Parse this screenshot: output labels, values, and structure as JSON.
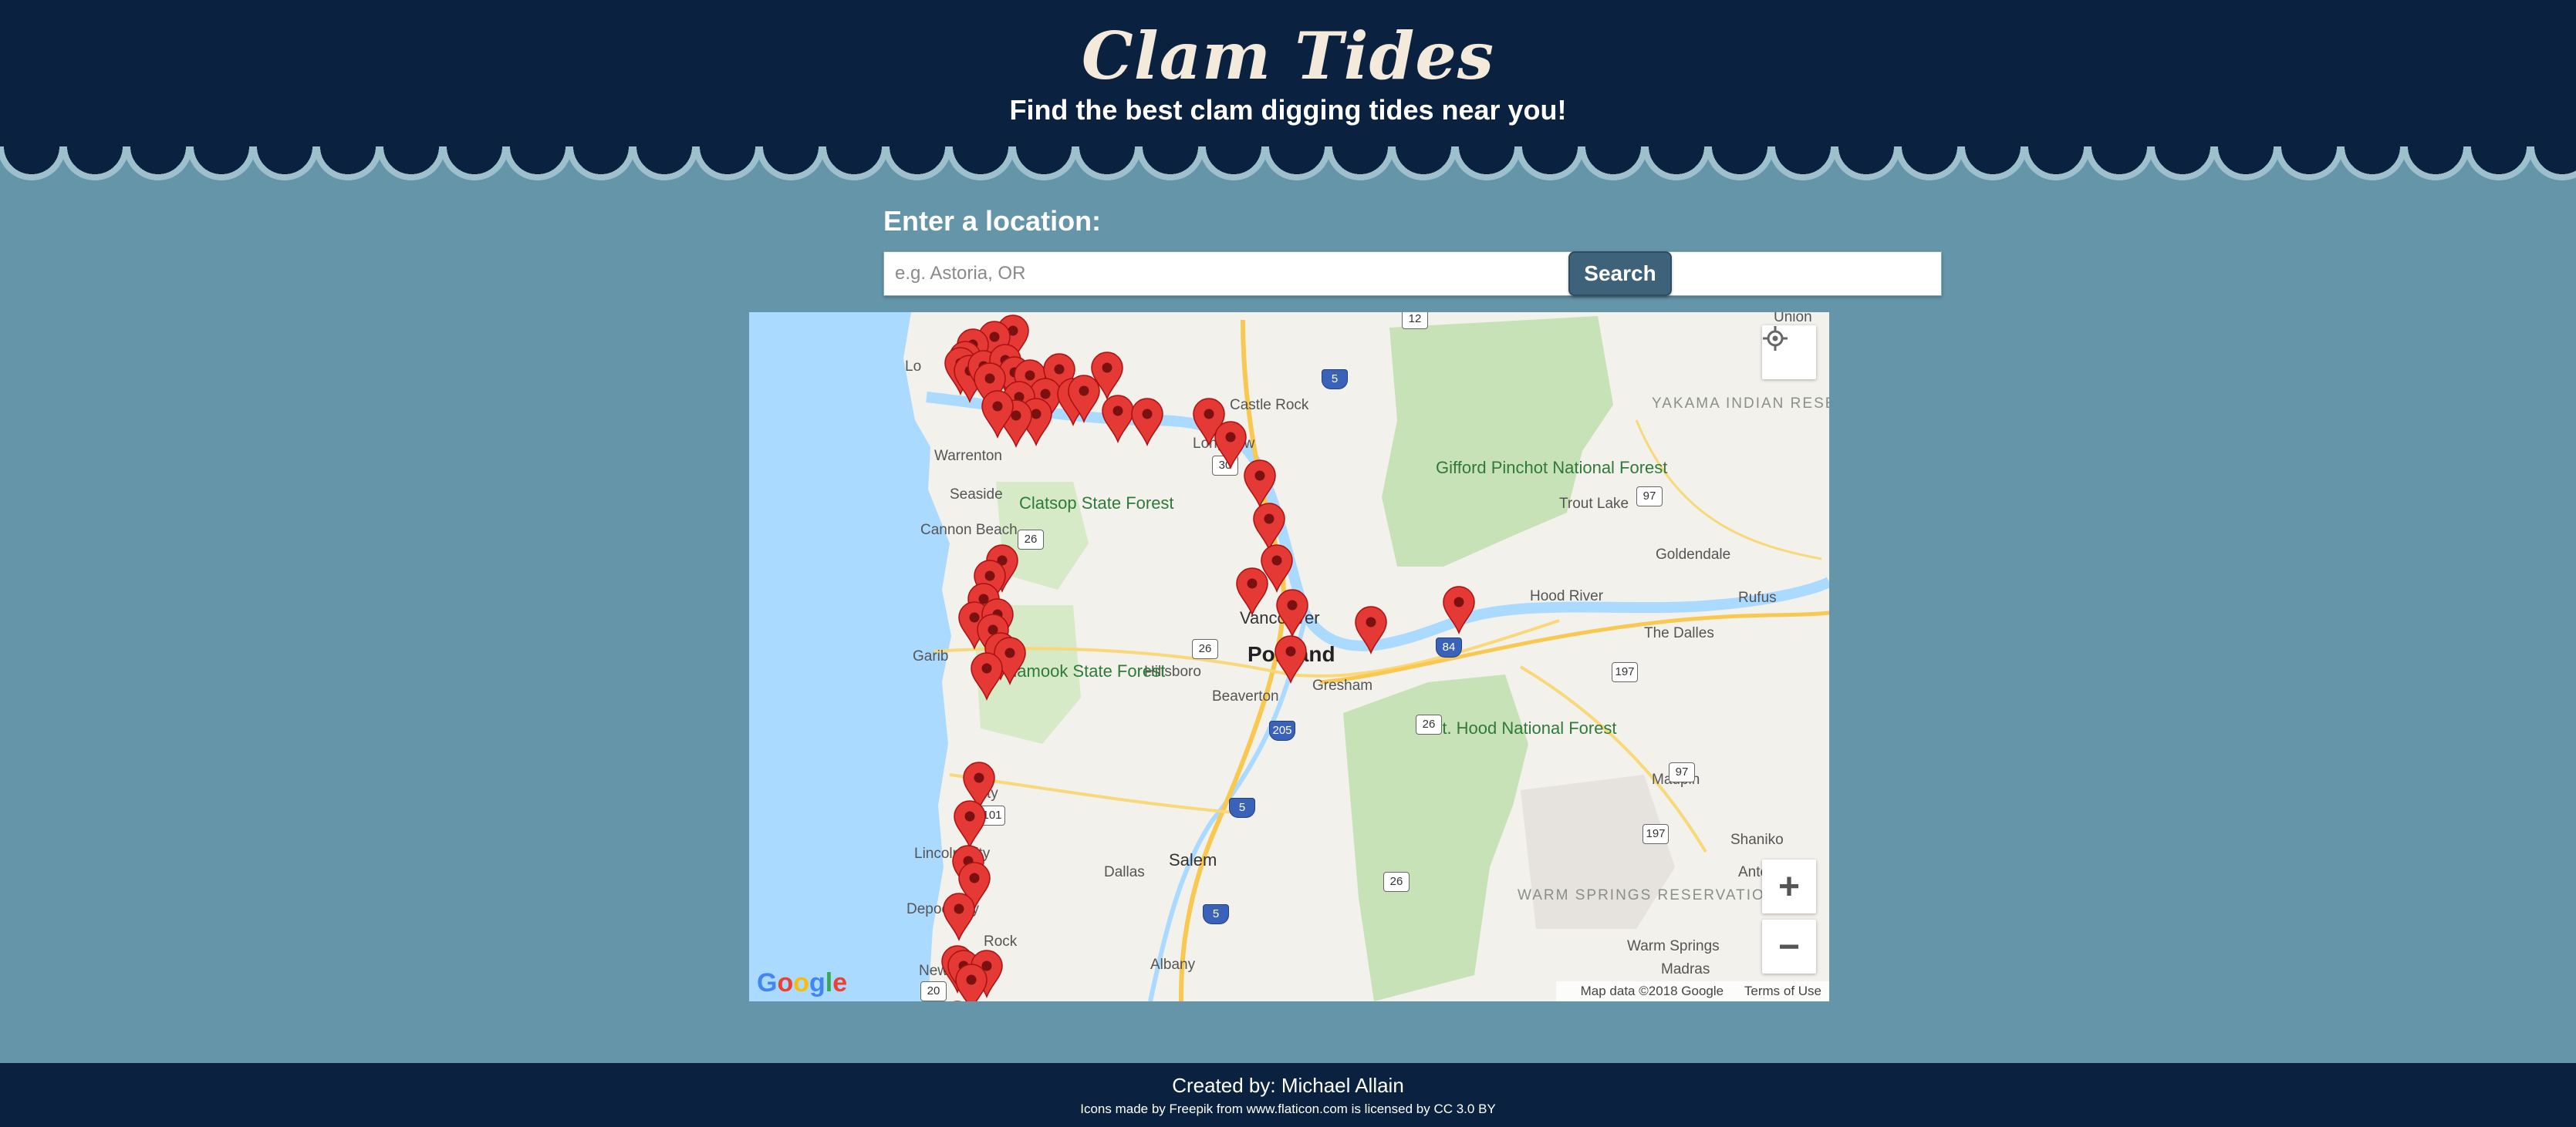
{
  "header": {
    "title": "Clam Tides",
    "subtitle": "Find the best clam digging tides near you!"
  },
  "search": {
    "label": "Enter a location:",
    "placeholder": "e.g. Astoria, OR",
    "button_label": "Search"
  },
  "map": {
    "labels": {
      "union": "Union",
      "castle_rock": "Castle Rock",
      "longview": "Longview",
      "warrenton": "Warrenton",
      "seaside": "Seaside",
      "cannon_beach": "Cannon Beach",
      "clatsop_forest": "Clatsop State Forest",
      "gifford_forest": "Gifford Pinchot National Forest",
      "yakama": "YAKAMA INDIAN RESERVATION",
      "trout_lake": "Trout Lake",
      "goldendale": "Goldendale",
      "hood_river": "Hood River",
      "rufus": "Rufus",
      "the_dalles": "The Dalles",
      "vancouver": "Vancouver",
      "portland": "Portland",
      "hillsboro": "Hillsboro",
      "gresham": "Gresham",
      "beaverton": "Beaverton",
      "tillamook_forest": "Tillamook State Forest",
      "garibaldi": "Garib",
      "mt_hood": "Mt. Hood National Forest",
      "maupin": "Maupin",
      "lincoln_city": "Lincoln City",
      "city": "City",
      "depoe_bay": "Depoe Bay",
      "dallas": "Dallas",
      "salem": "Salem",
      "shaniko": "Shaniko",
      "warm_springs_res": "WARM SPRINGS RESERVATION",
      "warm_springs": "Warm Springs",
      "antelope": "Ante",
      "madras": "Madras",
      "albany": "Albany",
      "rock": "Rock",
      "new": "New",
      "long": "Lo"
    },
    "shields": [
      "12",
      "5",
      "30",
      "26",
      "26",
      "97",
      "84",
      "197",
      "205",
      "5",
      "26",
      "101",
      "97",
      "197",
      "26",
      "5",
      "20"
    ],
    "attribution": "Map data ©2018 Google",
    "terms": "Terms of Use",
    "google": [
      "G",
      "o",
      "o",
      "g",
      "l",
      "e"
    ],
    "controls": {
      "locate": "crosshair-icon",
      "zoom_in": "+",
      "zoom_out": "−"
    },
    "marker_color": "#e53935"
  },
  "footer": {
    "credit": "Created by: Michael Allain",
    "icons_credit": "Icons made by Freepik from www.flaticon.com is licensed by CC 3.0 BY"
  }
}
